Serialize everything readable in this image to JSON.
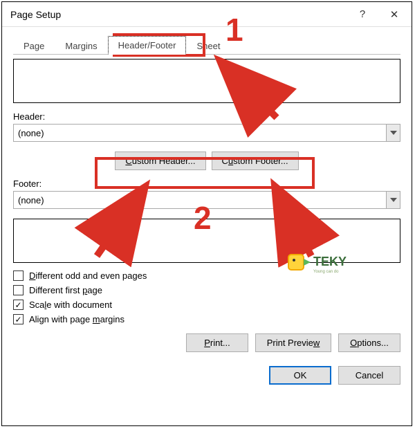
{
  "window": {
    "title": "Page Setup",
    "help_icon": "?",
    "close_icon": "✕"
  },
  "tabs": {
    "page": "Page",
    "margins": "Margins",
    "header_footer": "Header/Footer",
    "sheet": "Sheet"
  },
  "header_label": "Header:",
  "header_value": "(none)",
  "footer_label": "Footer:",
  "footer_value": "(none)",
  "buttons": {
    "custom_header": "Custom Header...",
    "custom_footer": "Custom Footer...",
    "print": "Print...",
    "print_preview": "Print Preview",
    "options": "Options...",
    "ok": "OK",
    "cancel": "Cancel"
  },
  "checkboxes": {
    "diff_odd_even": {
      "label": "Different odd and even pages",
      "checked": false
    },
    "diff_first": {
      "label": "Different first page",
      "checked": false
    },
    "scale": {
      "label": "Scale with document",
      "checked": true
    },
    "align": {
      "label": "Align with page margins",
      "checked": true
    }
  },
  "annotations": {
    "num1": "1",
    "num2": "2"
  },
  "watermark": "TEKY"
}
